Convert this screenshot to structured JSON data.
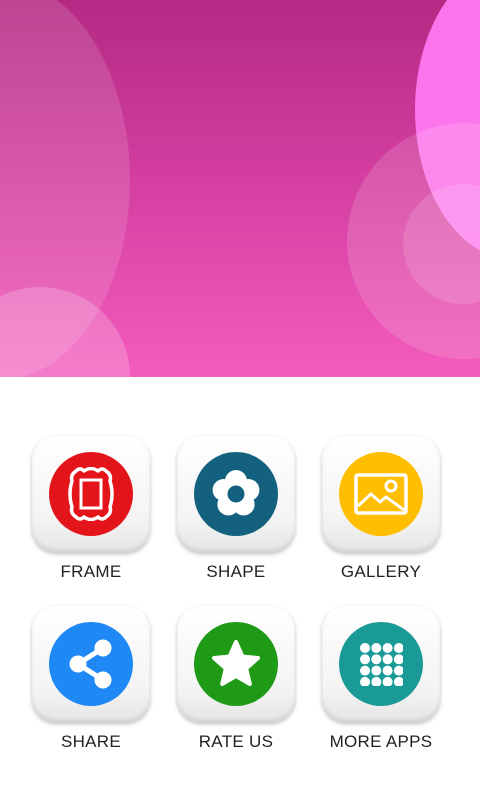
{
  "banner": {
    "background_colors": [
      "#b42a83",
      "#f35cbd"
    ]
  },
  "menu": {
    "items": [
      {
        "label": "FRAME",
        "icon": "frame-icon",
        "color": "#e4141b"
      },
      {
        "label": "SHAPE",
        "icon": "flower-icon",
        "color": "#14617f"
      },
      {
        "label": "GALLERY",
        "icon": "image-icon",
        "color": "#ffbe00"
      },
      {
        "label": "SHARE",
        "icon": "share-icon",
        "color": "#1e88f5"
      },
      {
        "label": "RATE US",
        "icon": "star-icon",
        "color": "#1f9a16"
      },
      {
        "label": "MORE APPS",
        "icon": "grid-icon",
        "color": "#1a9a96"
      }
    ]
  }
}
